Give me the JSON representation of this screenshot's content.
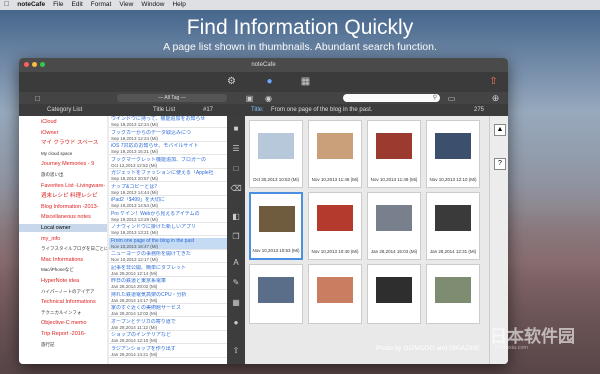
{
  "menubar": {
    "app": "noteCafe",
    "items": [
      "File",
      "Edit",
      "Format",
      "View",
      "Window",
      "Help"
    ]
  },
  "headline": {
    "title": "Find Information Quickly",
    "subtitle": "A page list shown in thumbnails.  Abundant search function."
  },
  "window": {
    "title": "noteCafe",
    "tag_filter": "— All Tag —",
    "columns": {
      "category": "Category List",
      "titles": "Title List",
      "title_count": "#17",
      "title_label": "Title:",
      "page_title": "From one page of the blog in the past.",
      "page_count": "275"
    },
    "categories": [
      {
        "label": "iCloud",
        "style": "red"
      },
      {
        "label": "iOwner",
        "style": "red"
      },
      {
        "label": "マイ クラウド スペース",
        "style": "red"
      },
      {
        "label": "My cloud space",
        "style": "sub"
      },
      {
        "label": "Journey Memories - 9",
        "style": "red"
      },
      {
        "label": "旅の思い出",
        "style": "sub"
      },
      {
        "label": "Favorites List -Livingware-",
        "style": "red"
      },
      {
        "label": "週末レシピ 料理レシピ",
        "style": "red"
      },
      {
        "label": "Blog Information -2013-",
        "style": "red"
      },
      {
        "label": "Miscellaneous notes",
        "style": "red"
      },
      {
        "label": "Local  owner",
        "style": "sel"
      },
      {
        "label": "my_info",
        "style": "red"
      },
      {
        "label": "ライフスタイルブログを日ごとに",
        "style": "sub"
      },
      {
        "label": "Mac Informations",
        "style": "red"
      },
      {
        "label": "Mac/iPhoneなど",
        "style": "sub"
      },
      {
        "label": "HyperNote idea",
        "style": "red"
      },
      {
        "label": "ハイパーノートのアイデア",
        "style": "sub"
      },
      {
        "label": "Technical Informations",
        "style": "red"
      },
      {
        "label": "テクニカルインフォ",
        "style": "sub"
      },
      {
        "label": "Objective-C memo",
        "style": "red"
      },
      {
        "label": "Trip Report -2016-",
        "style": "red"
      },
      {
        "label": "旅行記",
        "style": "sub"
      }
    ],
    "titles": [
      {
        "t": "ウインドウに持って、機能追加をお知らせ",
        "d": "Sep 19,2013 12:24 (Mi)"
      },
      {
        "t": "ブックカーからのデータ取込みにつ",
        "d": "Sep 19,2013 12:24 (Mi)"
      },
      {
        "t": "iOS 7対応のお知らせ、モバイルサイト",
        "d": "Sep 19,2013 16:21 (Mi)"
      },
      {
        "t": "ブックマークレット機能追加、ブロガーの",
        "d": "Oct 12,2013 12:52 (Mi)"
      },
      {
        "t": "ガジェットをファッションに使える「Apple社",
        "d": "Sep 19,2013 20:57 (Mi)"
      },
      {
        "t": "ナップ&コピーとは？",
        "d": "Sep 19,2013 14:44 (Mi)"
      },
      {
        "t": "iPad2「$499」を大切に",
        "d": "Sep 19,2013 14:54 (Mi)"
      },
      {
        "t": "Pro ケイン！Webから見えるアイテムの",
        "d": "Sep 19,2013 13:28 (Mi)"
      },
      {
        "t": "ノナウィンドウに掛けた新しいアプリ",
        "d": "Sep 19,2013 13:21 (Mi)"
      },
      {
        "t": "From one page of the blog in the past",
        "d": "Nov 10,2013 18:47 (Mi)"
      },
      {
        "t": "ニューヨークの事務所を開けてきた",
        "d": "Nov 10,2013 12:17 (Mi)"
      },
      {
        "t": "記事を非公開、簡単にタブレット",
        "d": "Jan 28,2014 12:14 (Mi)"
      },
      {
        "t": "昨日の鉄道と東京系電車",
        "d": "Jan 28,2014 20:02 (Mi)"
      },
      {
        "t": "持れた鉄道電気高架のCPU・分析",
        "d": "Jan 28,2014 14:17 (Mi)"
      },
      {
        "t": "家のすぐ近くの美術館サービス",
        "d": "Jan 28,2014 12:02 (Mi)"
      },
      {
        "t": "オープンとデリカの寄り道で",
        "d": "Jan 28,2014 11:12 (Mi)"
      },
      {
        "t": "ショップのインテリアなど",
        "d": "Jan 28,2014 12:10 (Mi)"
      },
      {
        "t": "ラジアンショップを作り出す",
        "d": "Jan 28,2014 14:21 (Mi)"
      }
    ],
    "thumbs": [
      {
        "cap": "Oct 30,2013 10:53 (Mi)",
        "sel": false
      },
      {
        "cap": "Nov 10,2013 11:48 (Mi)",
        "sel": false
      },
      {
        "cap": "Nov 10,2013 11:49 (Mi)",
        "sel": false
      },
      {
        "cap": "Nov 10,2013 12:10 (Mi)",
        "sel": false
      },
      {
        "cap": "Nov 10,2013 10:53 (Mi)",
        "sel": true
      },
      {
        "cap": "Nov 10,2013 10:40 (Mi)",
        "sel": false
      },
      {
        "cap": "Jan 28,2014 15:03 (Mi)",
        "sel": false
      },
      {
        "cap": "Jan 28,2014 12:31 (Mi)",
        "sel": false
      },
      {
        "cap": "",
        "sel": false
      },
      {
        "cap": "",
        "sel": false
      },
      {
        "cap": "",
        "sel": false
      },
      {
        "cap": "",
        "sel": false
      }
    ]
  },
  "credit": "Photo by GIZMODO and GIGAZINE",
  "watermark": {
    "main": "日本软件园",
    "sub": "Downxia.com"
  }
}
